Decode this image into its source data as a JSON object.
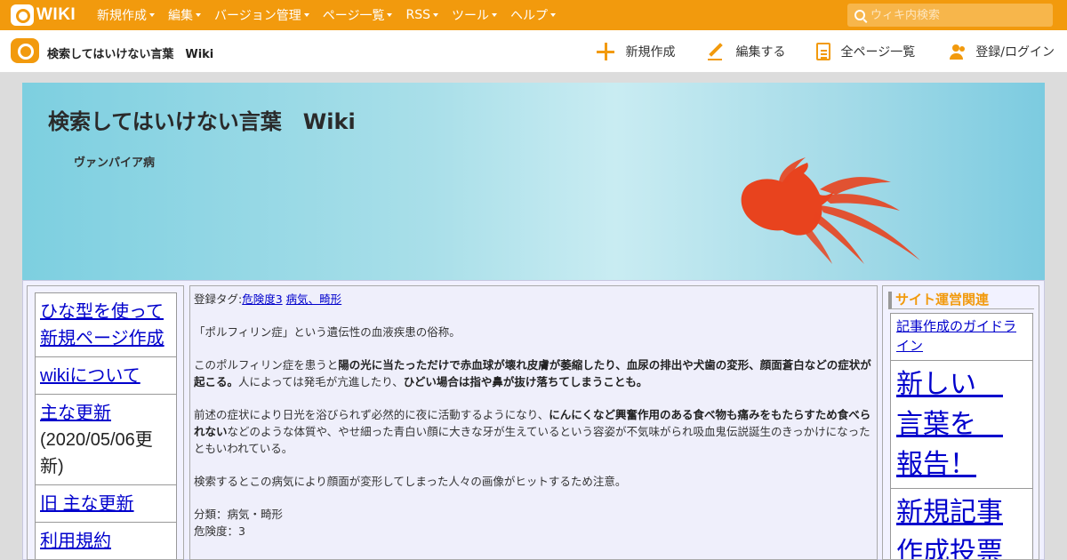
{
  "topbar": {
    "logo_text": "WIKI",
    "nav": [
      {
        "label": "新規作成"
      },
      {
        "label": "編集"
      },
      {
        "label": "バージョン管理"
      },
      {
        "label": "ページ一覧"
      },
      {
        "label": "RSS"
      },
      {
        "label": "ツール"
      },
      {
        "label": "ヘルプ"
      }
    ],
    "search_placeholder": "ウィキ内検索"
  },
  "subbar": {
    "site_name": "検索してはいけない言葉　Wiki",
    "actions": [
      {
        "label": "新規作成",
        "icon": "plus-icon"
      },
      {
        "label": "編集する",
        "icon": "pencil-icon"
      },
      {
        "label": "全ページ一覧",
        "icon": "document-icon"
      },
      {
        "label": "登録/ログイン",
        "icon": "users-icon"
      }
    ]
  },
  "banner": {
    "title": "検索してはいけない言葉　Wiki",
    "page_name": "ヴァンパイア病",
    "image": "goldfish-icon"
  },
  "left_menu": {
    "items": [
      {
        "link": "ひな型を使って新規ページ作成",
        "note": ""
      },
      {
        "link": "wikiについて",
        "note": ""
      },
      {
        "link": "主な更新",
        "note": "(2020/05/06更新)"
      },
      {
        "link": "旧 主な更新",
        "note": ""
      },
      {
        "link": "利用規約",
        "note": ""
      }
    ]
  },
  "content": {
    "tags_label": "登録タグ:",
    "tags": [
      "危険度3",
      "病気、畸形"
    ],
    "p1": "「ポルフィリン症」という遺伝性の血液疾患の俗称。",
    "p2_a": "このポルフィリン症を患うと",
    "p2_b": "陽の光に当たっただけで赤血球が壊れ皮膚が萎縮したり、血尿の排出や犬歯の変形、顔面蒼白などの症状が起こる。",
    "p2_c": "人によっては発毛が亢進したり、",
    "p2_d": "ひどい場合は指や鼻が抜け落ちてしまうことも。",
    "p3_a": "前述の症状により日光を浴びられず必然的に夜に活動するようになり、",
    "p3_b": "にんにくなど興奮作用のある食べ物も痛みをもたらすため食べられない",
    "p3_c": "などのような体質や、やせ細った青白い顔に大きな牙が生えているという容姿が不気味がられ吸血鬼伝説誕生のきっかけになったともいわれている。",
    "p4": "検索するとこの病気により顔面が変形してしまった人々の画像がヒットするため注意。",
    "category": "分類：病気・畸形",
    "danger": "危険度：3"
  },
  "right_menu": {
    "heading": "サイト運営関連",
    "items": [
      {
        "label": "記事作成のガイドライン",
        "size": "small"
      },
      {
        "label": "新しい　言葉を　報告！",
        "size": "big"
      },
      {
        "label": "新規記事作成投票",
        "size": "big"
      }
    ]
  },
  "colors": {
    "brand_orange": "#f29a0d",
    "banner_blue": "#7dcfe0",
    "link_blue": "#0000cc",
    "goldfish_red": "#e8431e"
  }
}
